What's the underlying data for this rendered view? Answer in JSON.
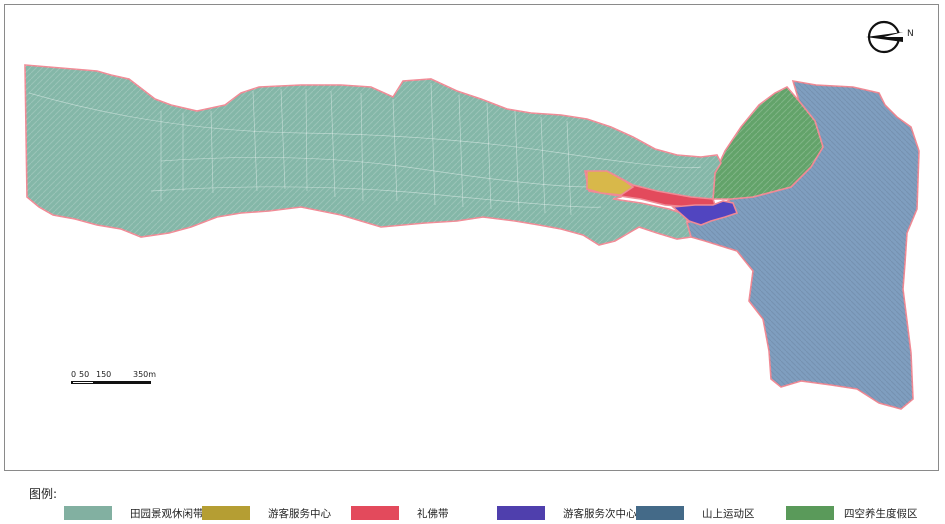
{
  "legend": {
    "title": "图例:",
    "items": [
      {
        "label": "田园景观休闲带",
        "color": "#82b0a1"
      },
      {
        "label": "游客服务中心",
        "color": "#b59e33"
      },
      {
        "label": "礼佛带",
        "color": "#e34a5c"
      },
      {
        "label": "游客服务次中心",
        "color": "#4f3fad"
      },
      {
        "label": "山上运动区",
        "color": "#446a88"
      },
      {
        "label": "四空养生度假区",
        "color": "#5a9a5a"
      }
    ]
  },
  "scale_bar": {
    "ticks": [
      "0",
      "50",
      "150",
      "350m"
    ]
  },
  "north_arrow": {
    "label": "N"
  },
  "zone_colors": {
    "rural": "#84b7a8",
    "visitor_center": "#d8b84a",
    "buddhist": "#e34a5c",
    "sub_center": "#5145c0",
    "mountain": "#7f9ebf",
    "wellness": "#63a36a",
    "boundary": "#f08a95"
  }
}
